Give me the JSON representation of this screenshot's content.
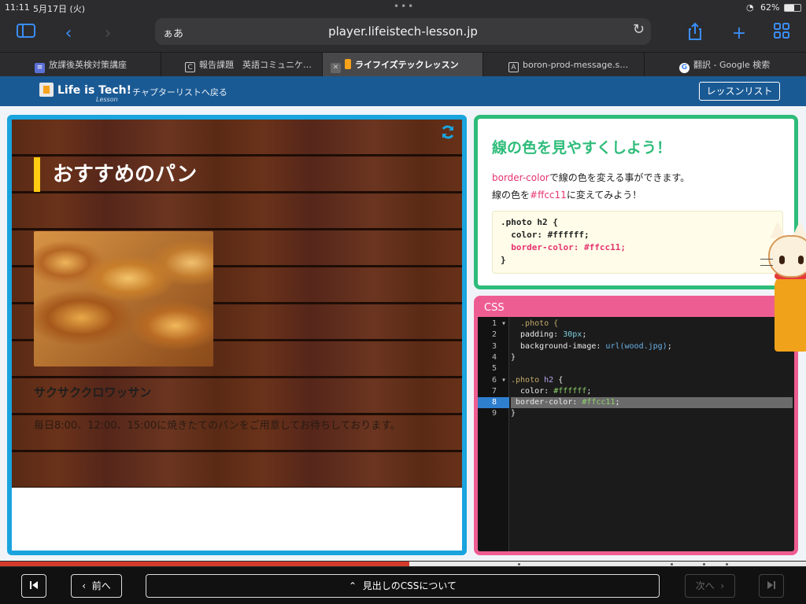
{
  "status": {
    "time": "11:11",
    "date": "5月17日 (火)",
    "battery": "62%"
  },
  "browser": {
    "address_aa": "ぁあ",
    "url": "player.lifeistech-lesson.jp",
    "tabs": [
      {
        "label": "放課後英検対策講座",
        "icon": "app-icon"
      },
      {
        "label": "報告課題　英語コミュニケ…",
        "icon": "classroom-icon"
      },
      {
        "label": "ライフイズテックレッスン",
        "icon": "lifeistech-icon",
        "active": true
      },
      {
        "label": "boron-prod-message.s…",
        "icon": "a-icon"
      },
      {
        "label": "翻訳 - Google 検索",
        "icon": "google-icon"
      }
    ]
  },
  "site": {
    "logo": "Life is Tech!",
    "logo_sub": "Lesson",
    "back_link": "チャプターリストへ戻る",
    "lesson_list": "レッスンリスト"
  },
  "preview": {
    "heading": "おすすめのパン",
    "product_name": "サクサククロワッサン",
    "product_desc": "毎日8:00、12:00、15:00に焼きたてのパンをご用意してお待ちしております。"
  },
  "instruction": {
    "title": "線の色を見やすくしよう！",
    "line1_pre": "border-color",
    "line1_post": "で線の色を変える事ができます。",
    "line2_pre": "線の色を",
    "line2_hex": "#ffcc11",
    "line2_post": "に変えてみよう！",
    "code": [
      ".photo h2 {",
      "  color: #ffffff;",
      "  border-color: #ffcc11;",
      "}"
    ]
  },
  "editor": {
    "title": "CSS",
    "search_icon_label": "Q",
    "lines": [
      {
        "no": "1",
        "fold": "▾",
        "selector": "  .photo {"
      },
      {
        "no": "2",
        "prop": "  padding: ",
        "value": "30px",
        "type": "num",
        "end": ";"
      },
      {
        "no": "3",
        "prop": "  background-image: ",
        "value": "url(wood.jpg)",
        "type": "fn",
        "end": ";"
      },
      {
        "no": "4",
        "plain": "}"
      },
      {
        "no": "5",
        "plain": ""
      },
      {
        "no": "6",
        "fold": "▾",
        "selector": ".photo ",
        "tag": "h2",
        "post": " {"
      },
      {
        "no": "7",
        "prop": "  color: ",
        "value": "#ffffff",
        "type": "hex",
        "end": ";"
      },
      {
        "no": "8",
        "prop": " border-color: ",
        "value": "#ffcc11",
        "type": "hex",
        "end": ";",
        "active": true
      },
      {
        "no": "9",
        "plain": "}"
      }
    ]
  },
  "progress": {
    "value": 0.508
  },
  "nav": {
    "prev": "前へ",
    "center": "見出しのCSSについて",
    "next": "次へ"
  },
  "colors": {
    "preview_border": "#1aa4de",
    "instruction_border": "#2ebc7a",
    "editor_border": "#ee5d91",
    "heading_bar": "#ffcc11",
    "accent_pink": "#e6336f",
    "site_header": "#1a5a94"
  }
}
